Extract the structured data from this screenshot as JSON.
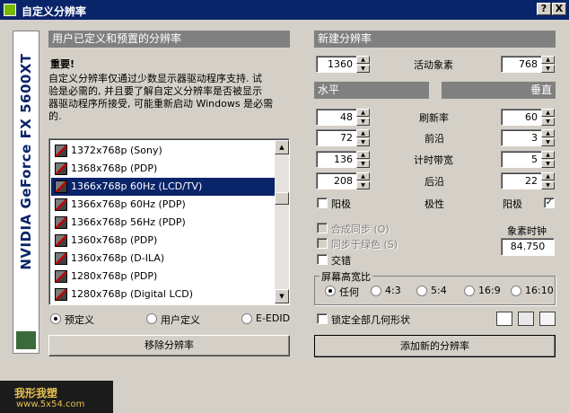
{
  "window": {
    "title": "自定义分辨率",
    "help_btn": "?",
    "close_btn": "X"
  },
  "sidebar": {
    "product": "NVIDIA GeForce FX 5600XT"
  },
  "left": {
    "header": "用户已定义和预置的分辨率",
    "important_title": "重要!",
    "important_text": [
      "自定义分辨率仅通过少数显示器驱动程序支持. 试",
      "验是必需的, 并且要了解自定义分辨率是否被显示",
      "器驱动程序所接受, 可能重新启动 Windows 是必需",
      "的."
    ],
    "list": [
      "1372x768p (Sony)",
      "1368x768p (PDP)",
      "1366x768p 60Hz (LCD/TV)",
      "1366x768p 60Hz (PDP)",
      "1366x768p 56Hz (PDP)",
      "1360x768p (PDP)",
      "1360x768p (D-ILA)",
      "1280x768p (PDP)",
      "1280x768p (Digital LCD)"
    ],
    "selected_index": 2,
    "radios": [
      "预定义",
      "用户定义",
      "E-EDID"
    ],
    "radio_selected": 0,
    "remove_button": "移除分辨率"
  },
  "right": {
    "header": "新建分辨率",
    "active_pixels_label": "活动象素",
    "horizontal_label": "水平",
    "vertical_label": "垂直",
    "h_active": "1360",
    "v_active": "768",
    "rows": [
      {
        "label": "刷新率",
        "h": "48",
        "v": "60"
      },
      {
        "label": "前沿",
        "h": "72",
        "v": "3"
      },
      {
        "label": "计时带宽",
        "h": "136",
        "v": "5"
      },
      {
        "label": "后沿",
        "h": "208",
        "v": "22"
      }
    ],
    "polarity_label": "极性",
    "h_polarity_label": "阳极",
    "v_polarity_label": "阳极",
    "h_polarity_checked": false,
    "v_polarity_checked": true,
    "composite_sync": "合成同步 (O)",
    "sync_on_green": "同步于绿色 (S)",
    "interlace": "交错",
    "pixel_clock_label": "象素时钟",
    "pixel_clock_value": "84.750",
    "aspect_label": "屏幕高宽比",
    "aspect_options": [
      "任何",
      "4:3",
      "5:4",
      "16:9",
      "16:10"
    ],
    "aspect_selected": 0,
    "lock_geometry": "锁定全部几何形状",
    "add_button": "添加新的分辨率"
  },
  "watermark": {
    "line1": "我形我塑",
    "line2": "www.5x54.com"
  },
  "colors": {
    "titlebar": "#0a246a",
    "selection": "#0a246a",
    "face": "#d4d0c8",
    "header": "#808080",
    "nvidia_green": "#76b900"
  }
}
